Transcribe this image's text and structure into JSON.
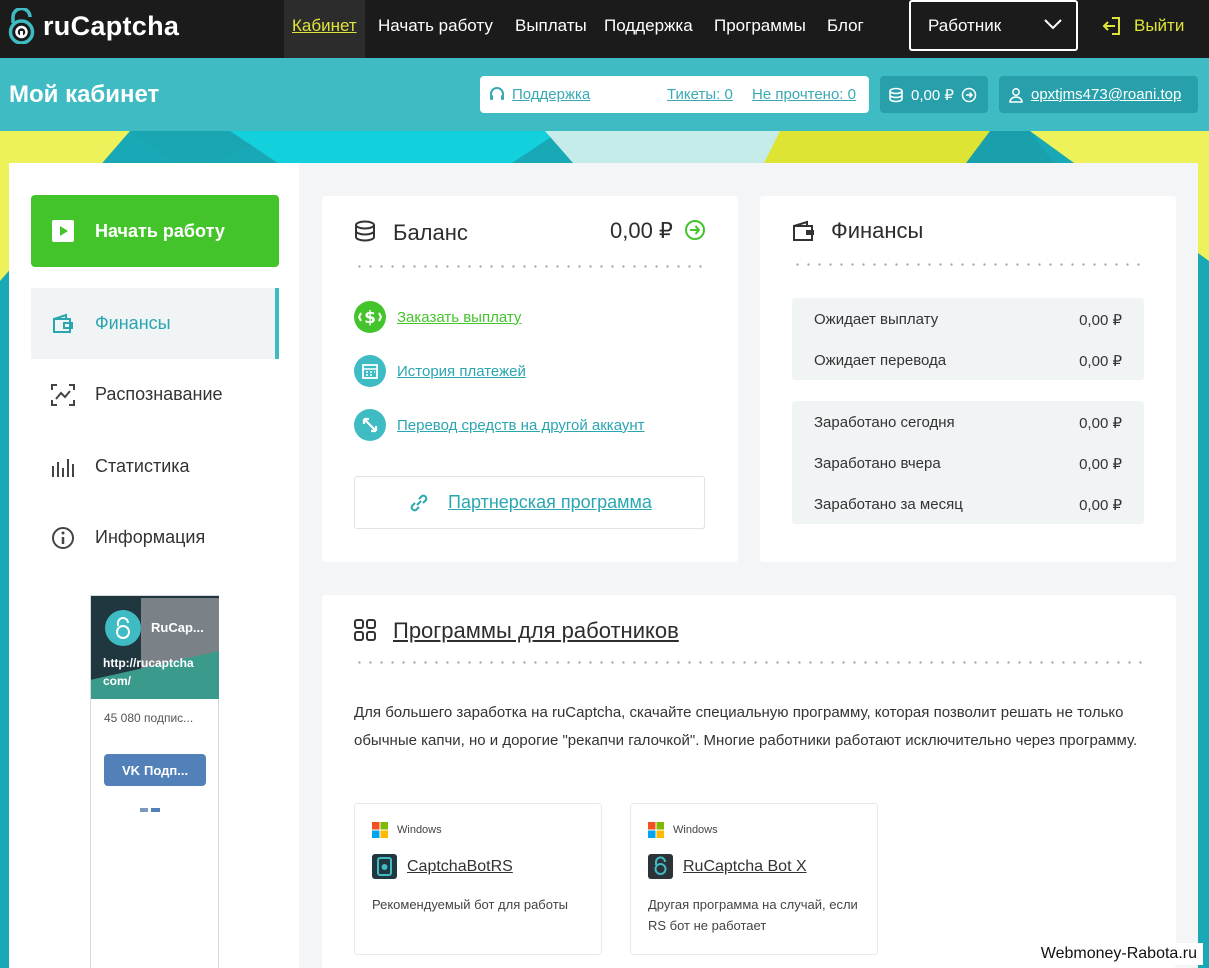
{
  "brand": {
    "name": "ruCaptcha"
  },
  "nav": {
    "items": [
      "Кабинет",
      "Начать работу",
      "Выплаты",
      "Поддержка",
      "Программы",
      "Блог"
    ],
    "role": "Работник",
    "logout": "Выйти"
  },
  "subheader": {
    "title": "Мой кабинет",
    "support": "Поддержка",
    "tickets": "Тикеты: 0",
    "unread": "Не прочтено: 0",
    "balance": "0,00 ₽",
    "email": "opxtjms473@roani.top"
  },
  "sidebar": {
    "start": "Начать работу",
    "items": [
      "Финансы",
      "Распознавание",
      "Статистика",
      "Информация"
    ],
    "vk": {
      "name": "RuCap...",
      "url_line1": "http://rucaptcha",
      "url_line2": "com/",
      "subscribers": "45 080 подпис...",
      "button": "Подп..."
    }
  },
  "balance_card": {
    "title": "Баланс",
    "amount": "0,00 ₽",
    "links": [
      "Заказать выплату",
      "История платежей",
      "Перевод средств на другой аккаунт"
    ],
    "partner": "Партнерская программа"
  },
  "finance_card": {
    "title": "Финансы",
    "pending": [
      {
        "label": "Ожидает выплату",
        "value": "0,00 ₽"
      },
      {
        "label": "Ожидает перевода",
        "value": "0,00 ₽"
      }
    ],
    "earned": [
      {
        "label": "Заработано сегодня",
        "value": "0,00 ₽"
      },
      {
        "label": "Заработано вчера",
        "value": "0,00 ₽"
      },
      {
        "label": "Заработано за месяц",
        "value": "0,00 ₽"
      }
    ]
  },
  "programs_card": {
    "title": "Программы для работников",
    "description": "Для большего заработка на ruCaptcha, скачайте специальную программу, которая позволит решать не только обычные капчи, но и дорогие \"рекапчи галочкой\". Многие работники работают исключительно через программу.",
    "programs": [
      {
        "os": "Windows",
        "name": "CaptchaBotRS",
        "desc": "Рекомендуемый бот для работы"
      },
      {
        "os": "Windows",
        "name": "RuCaptcha Bot X",
        "desc": "Другая программа на случай, если RS бот не работает"
      }
    ]
  },
  "watermark": "Webmoney-Rabota.ru",
  "colors": {
    "accent_teal": "#3fbcc3",
    "accent_green": "#44c42b",
    "nav_yellow": "#dfe33a",
    "vk_blue": "#5181b8"
  }
}
